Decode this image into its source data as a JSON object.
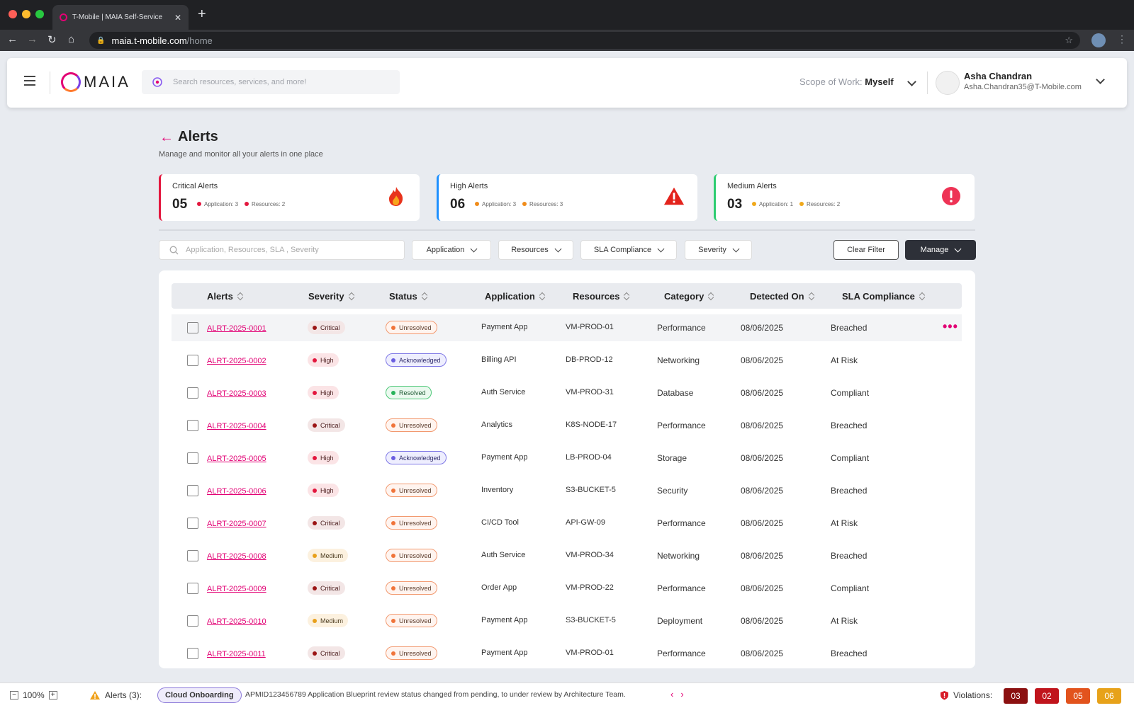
{
  "browser": {
    "tab_title": "T-Mobile | MAIA Self-Service",
    "url_host": "maia.t-mobile.com",
    "url_path": "/home"
  },
  "app": {
    "logo_text": "MAIA",
    "search_placeholder": "Search resources, services, and more!",
    "scope_label": "Scope of Work:",
    "scope_value": "Myself",
    "user_name": "Asha Chandran",
    "user_email": "Asha.Chandran35@T-Mobile.com"
  },
  "page": {
    "title": "Alerts",
    "subtitle": "Manage and monitor all your alerts in one place"
  },
  "summary_cards": [
    {
      "title": "Critical Alerts",
      "count": "05",
      "app_label": "Application: 3",
      "res_label": "Resources: 2",
      "color": "#e3173e",
      "icon": "fire-icon"
    },
    {
      "title": "High Alerts",
      "count": "06",
      "app_label": "Application: 3",
      "res_label": "Resources: 3",
      "color": "#1e90ff",
      "icon": "warning-triangle-icon"
    },
    {
      "title": "Medium Alerts",
      "count": "03",
      "app_label": "Application: 1",
      "res_label": "Resources: 2",
      "color": "#2ecc71",
      "icon": "exclamation-circle-icon"
    }
  ],
  "filters": {
    "search_placeholder": "Application, Resources, SLA , Severity",
    "dropdowns": [
      "Application",
      "Resources",
      "SLA Compliance",
      "Severity"
    ],
    "clear_label": "Clear Filter",
    "manage_label": "Manage"
  },
  "table": {
    "columns": [
      "Alerts",
      "Severity",
      "Status",
      "Application",
      "Resources",
      "Category",
      "Detected On",
      "SLA Compliance"
    ],
    "rows": [
      {
        "id": "ALRT-2025-0001",
        "severity": "Critical",
        "status": "Unresolved",
        "application": "Payment App",
        "resource": "VM-PROD-01",
        "category": "Performance",
        "detected": "08/06/2025",
        "sla": "Breached"
      },
      {
        "id": "ALRT-2025-0002",
        "severity": "High",
        "status": "Acknowledged",
        "application": "Billing API",
        "resource": "DB-PROD-12",
        "category": "Networking",
        "detected": "08/06/2025",
        "sla": "At Risk"
      },
      {
        "id": "ALRT-2025-0003",
        "severity": "High",
        "status": "Resolved",
        "application": "Auth Service",
        "resource": "VM-PROD-31",
        "category": "Database",
        "detected": "08/06/2025",
        "sla": "Compliant"
      },
      {
        "id": "ALRT-2025-0004",
        "severity": "Critical",
        "status": "Unresolved",
        "application": "Analytics",
        "resource": "K8S-NODE-17",
        "category": "Performance",
        "detected": "08/06/2025",
        "sla": "Breached"
      },
      {
        "id": "ALRT-2025-0005",
        "severity": "High",
        "status": "Acknowledged",
        "application": "Payment App",
        "resource": "LB-PROD-04",
        "category": "Storage",
        "detected": "08/06/2025",
        "sla": "Compliant"
      },
      {
        "id": "ALRT-2025-0006",
        "severity": "High",
        "status": "Unresolved",
        "application": "Inventory",
        "resource": "S3-BUCKET-5",
        "category": "Security",
        "detected": "08/06/2025",
        "sla": "Breached"
      },
      {
        "id": "ALRT-2025-0007",
        "severity": "Critical",
        "status": "Unresolved",
        "application": "CI/CD Tool",
        "resource": "API-GW-09",
        "category": "Performance",
        "detected": "08/06/2025",
        "sla": "At Risk"
      },
      {
        "id": "ALRT-2025-0008",
        "severity": "Medium",
        "status": "Unresolved",
        "application": "Auth Service",
        "resource": "VM-PROD-34",
        "category": "Networking",
        "detected": "08/06/2025",
        "sla": "Breached"
      },
      {
        "id": "ALRT-2025-0009",
        "severity": "Critical",
        "status": "Unresolved",
        "application": "Order App",
        "resource": "VM-PROD-22",
        "category": "Performance",
        "detected": "08/06/2025",
        "sla": "Compliant"
      },
      {
        "id": "ALRT-2025-0010",
        "severity": "Medium",
        "status": "Unresolved",
        "application": "Payment App",
        "resource": "S3-BUCKET-5",
        "category": "Deployment",
        "detected": "08/06/2025",
        "sla": "At Risk"
      },
      {
        "id": "ALRT-2025-0011",
        "severity": "Critical",
        "status": "Unresolved",
        "application": "Payment App",
        "resource": "VM-PROD-01",
        "category": "Performance",
        "detected": "08/06/2025",
        "sla": "Breached"
      }
    ]
  },
  "status_bar": {
    "zoom": "100%",
    "alerts_label": "Alerts (3):",
    "chip": "Cloud Onboarding",
    "message": "APMID123456789 Application Blueprint review status changed from pending, to under review by Architecture Team.",
    "violations_label": "Violations:",
    "violations": [
      {
        "value": "03",
        "bg": "#8b1010",
        "fg": "#ffffff"
      },
      {
        "value": "02",
        "bg": "#c0141c",
        "fg": "#ffffff"
      },
      {
        "value": "05",
        "bg": "#e2531d",
        "fg": "#ffffff"
      },
      {
        "value": "06",
        "bg": "#e7a21a",
        "fg": "#ffffff"
      }
    ]
  }
}
